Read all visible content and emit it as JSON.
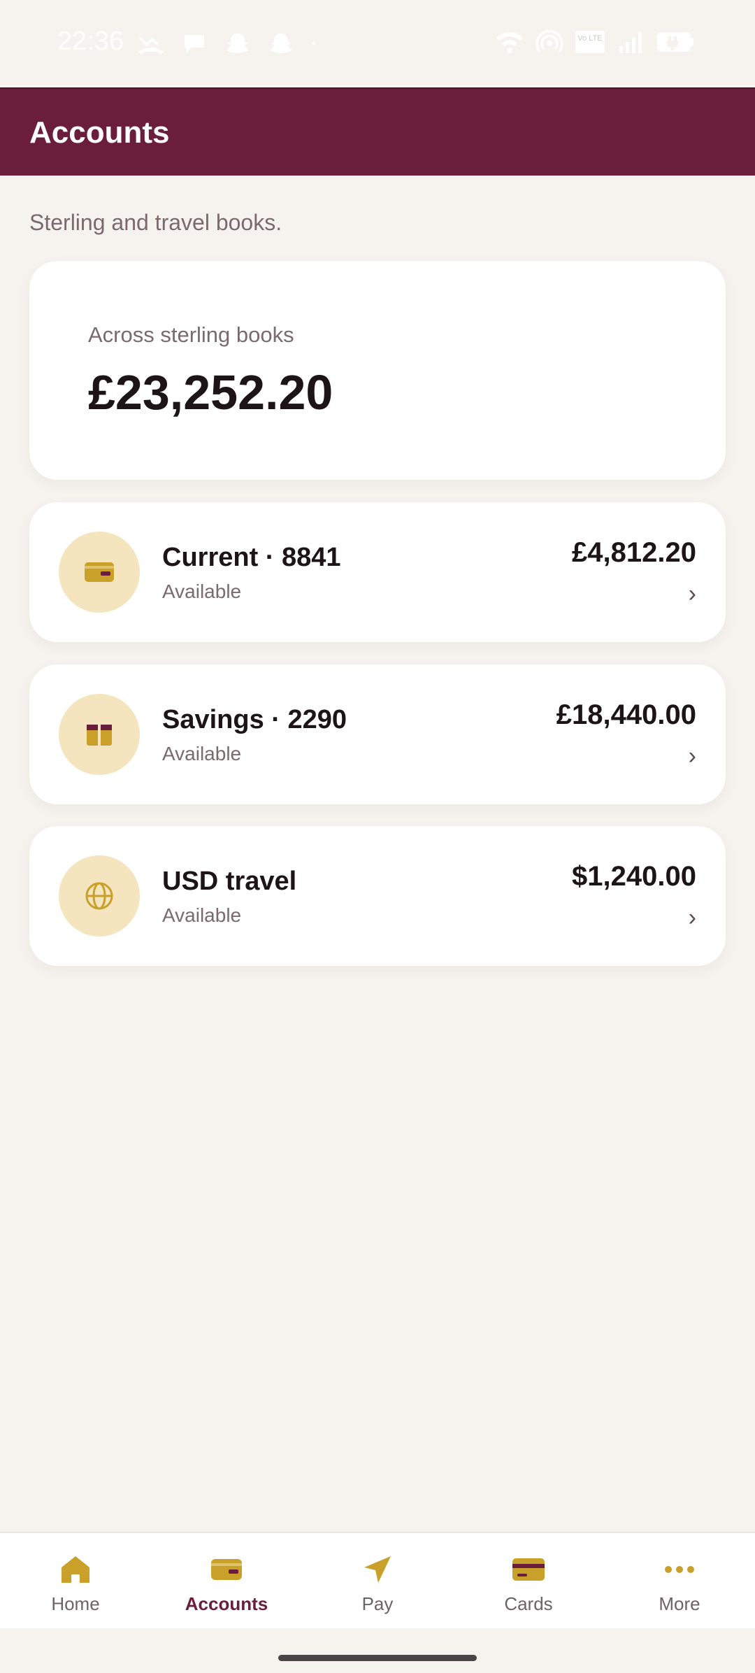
{
  "status_bar": {
    "time": "22:36",
    "left_icons": [
      "missed-call-icon",
      "chat-bubble-icon",
      "snapchat-icon",
      "snapchat-icon",
      "dot-icon"
    ],
    "right_icons": [
      "wifi-icon",
      "hotspot-icon",
      "volte-icon",
      "signal-icon",
      "battery-charging-icon"
    ],
    "volte_label": "Vo LTE"
  },
  "app_bar": {
    "title": "Accounts"
  },
  "subtitle": "Sterling and travel books.",
  "total": {
    "label": "Across sterling books",
    "value": "£23,252.20"
  },
  "accounts": [
    {
      "name": "Current · 8841",
      "sub": "Available",
      "amount": "£4,812.20",
      "icon": "wallet-icon",
      "chevron": "›"
    },
    {
      "name": "Savings · 2290",
      "sub": "Available",
      "amount": "£18,440.00",
      "icon": "gift-icon",
      "chevron": "›"
    },
    {
      "name": "USD travel",
      "sub": "Available",
      "amount": "$1,240.00",
      "icon": "globe-icon",
      "chevron": "›"
    }
  ],
  "bottom_nav": {
    "items": [
      {
        "label": "Home",
        "icon": "home-icon",
        "active": false
      },
      {
        "label": "Accounts",
        "icon": "wallet-icon",
        "active": true
      },
      {
        "label": "Pay",
        "icon": "send-icon",
        "active": false
      },
      {
        "label": "Cards",
        "icon": "card-icon",
        "active": false
      },
      {
        "label": "More",
        "icon": "more-dots-icon",
        "active": false
      }
    ]
  },
  "colors": {
    "brand": "#6b1e3c",
    "accent_gold": "#c9a02a",
    "icon_bg": "#f4e5bf",
    "background": "#f6f3ef"
  }
}
